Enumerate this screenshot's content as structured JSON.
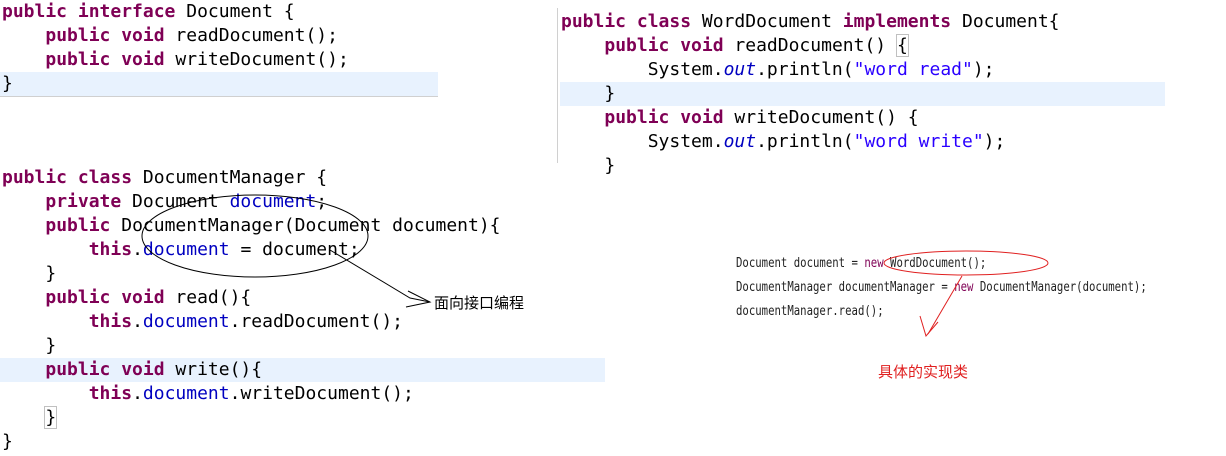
{
  "block1": {
    "lines": [
      [
        {
          "t": "public interface",
          "c": "kw"
        },
        {
          "t": " Document {",
          "c": ""
        }
      ],
      [
        {
          "t": "    ",
          "c": ""
        },
        {
          "t": "public void",
          "c": "kw"
        },
        {
          "t": " readDocument();",
          "c": ""
        }
      ],
      [
        {
          "t": "    ",
          "c": ""
        },
        {
          "t": "public void",
          "c": "kw"
        },
        {
          "t": " writeDocument();",
          "c": ""
        }
      ],
      [
        {
          "t": "}",
          "c": ""
        }
      ]
    ]
  },
  "block2": {
    "lines": [
      [
        {
          "t": "public class",
          "c": "kw"
        },
        {
          "t": " WordDocument ",
          "c": ""
        },
        {
          "t": "implements",
          "c": "kw"
        },
        {
          "t": " Document{",
          "c": ""
        }
      ],
      [
        {
          "t": "    ",
          "c": ""
        },
        {
          "t": "public void",
          "c": "kw"
        },
        {
          "t": " readDocument() ",
          "c": ""
        },
        {
          "t": "{",
          "c": "box"
        }
      ],
      [
        {
          "t": "        System.",
          "c": ""
        },
        {
          "t": "out",
          "c": "sfld"
        },
        {
          "t": ".println(",
          "c": ""
        },
        {
          "t": "\"word read\"",
          "c": "str"
        },
        {
          "t": ");",
          "c": ""
        }
      ],
      [
        {
          "t": "    }",
          "c": ""
        }
      ],
      [
        {
          "t": "    ",
          "c": ""
        },
        {
          "t": "public void",
          "c": "kw"
        },
        {
          "t": " writeDocument() {",
          "c": ""
        }
      ],
      [
        {
          "t": "        System.",
          "c": ""
        },
        {
          "t": "out",
          "c": "sfld"
        },
        {
          "t": ".println(",
          "c": ""
        },
        {
          "t": "\"word write\"",
          "c": "str"
        },
        {
          "t": ");",
          "c": ""
        }
      ],
      [
        {
          "t": "    }",
          "c": ""
        }
      ]
    ]
  },
  "block3": {
    "lines": [
      [
        {
          "t": "public class",
          "c": "kw"
        },
        {
          "t": " DocumentManager {",
          "c": ""
        }
      ],
      [
        {
          "t": "    ",
          "c": ""
        },
        {
          "t": "private",
          "c": "kw"
        },
        {
          "t": " Document ",
          "c": ""
        },
        {
          "t": "document",
          "c": "fld"
        },
        {
          "t": ";",
          "c": ""
        }
      ],
      [
        {
          "t": "    ",
          "c": ""
        },
        {
          "t": "public",
          "c": "kw"
        },
        {
          "t": " DocumentManager(Document document){",
          "c": ""
        }
      ],
      [
        {
          "t": "        ",
          "c": ""
        },
        {
          "t": "this",
          "c": "kw"
        },
        {
          "t": ".",
          "c": ""
        },
        {
          "t": "document",
          "c": "fld"
        },
        {
          "t": " = document;",
          "c": ""
        }
      ],
      [
        {
          "t": "    }",
          "c": ""
        }
      ],
      [
        {
          "t": "    ",
          "c": ""
        },
        {
          "t": "public void",
          "c": "kw"
        },
        {
          "t": " read(){",
          "c": ""
        }
      ],
      [
        {
          "t": "        ",
          "c": ""
        },
        {
          "t": "this",
          "c": "kw"
        },
        {
          "t": ".",
          "c": ""
        },
        {
          "t": "document",
          "c": "fld"
        },
        {
          "t": ".readDocument();",
          "c": ""
        }
      ],
      [
        {
          "t": "    }",
          "c": ""
        }
      ],
      [
        {
          "t": "    ",
          "c": ""
        },
        {
          "t": "public void",
          "c": "kw"
        },
        {
          "t": " write(){",
          "c": ""
        }
      ],
      [
        {
          "t": "        ",
          "c": ""
        },
        {
          "t": "this",
          "c": "kw"
        },
        {
          "t": ".",
          "c": ""
        },
        {
          "t": "document",
          "c": "fld"
        },
        {
          "t": ".writeDocument();",
          "c": ""
        }
      ],
      [
        {
          "t": "    ",
          "c": ""
        },
        {
          "t": "}",
          "c": "box"
        }
      ],
      [
        {
          "t": "}",
          "c": ""
        }
      ]
    ]
  },
  "snippet": {
    "lines": [
      [
        {
          "t": "Document document = ",
          "c": ""
        },
        {
          "t": "new",
          "c": "kw2"
        },
        {
          "t": " WordDocument();",
          "c": ""
        }
      ],
      [
        {
          "t": "DocumentManager documentManager = ",
          "c": ""
        },
        {
          "t": "new",
          "c": "kw2"
        },
        {
          "t": " DocumentManager(document);",
          "c": ""
        }
      ],
      [
        {
          "t": "documentManager.read();",
          "c": ""
        }
      ]
    ]
  },
  "annotations": {
    "interface_note": "面向接口编程",
    "impl_note": "具体的实现类"
  },
  "colors": {
    "keyword": "#7f0055",
    "field": "#0000c0",
    "string": "#2a00ff",
    "highlight": "#e8f2fe",
    "annotation_red": "#e02020"
  }
}
